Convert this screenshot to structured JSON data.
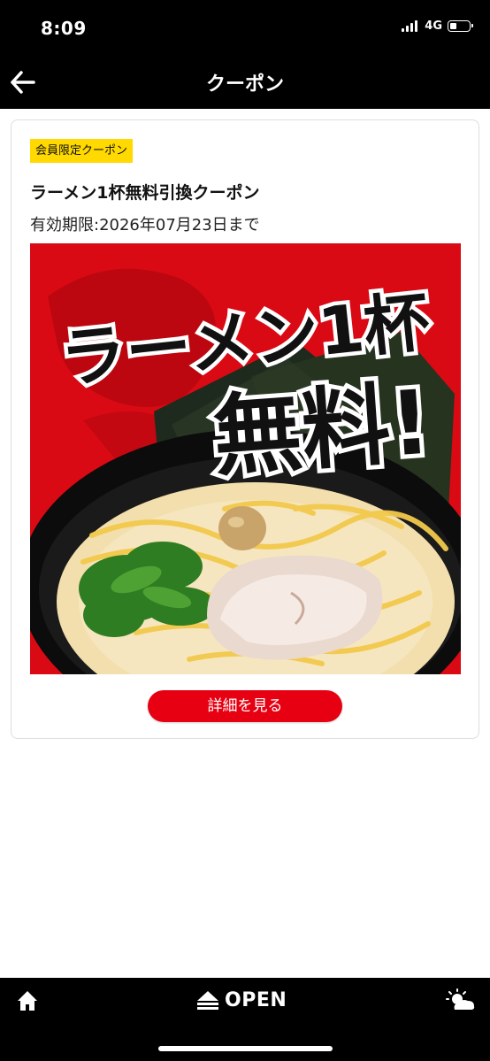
{
  "status_bar": {
    "time": "8:09",
    "network": "4G",
    "battery_level": 0.35
  },
  "header": {
    "title": "クーポン",
    "back_icon": "arrow-left-icon"
  },
  "coupon": {
    "badge": "会員限定クーポン",
    "title": "ラーメン1杯無料引換クーポン",
    "expiry": "有効期限:2026年07月23日まで",
    "image_text_line1": "ラーメン1杯",
    "image_text_line2": "無料!",
    "detail_button": "詳細を見る"
  },
  "bottom_bar": {
    "home_icon": "home-icon",
    "open_icon": "eject-icon",
    "open_label": "OPEN",
    "weather_icon": "sun-cloud-icon"
  },
  "colors": {
    "accent_red": "#e60012",
    "badge_yellow": "#ffd900",
    "bar_black": "#000000"
  }
}
